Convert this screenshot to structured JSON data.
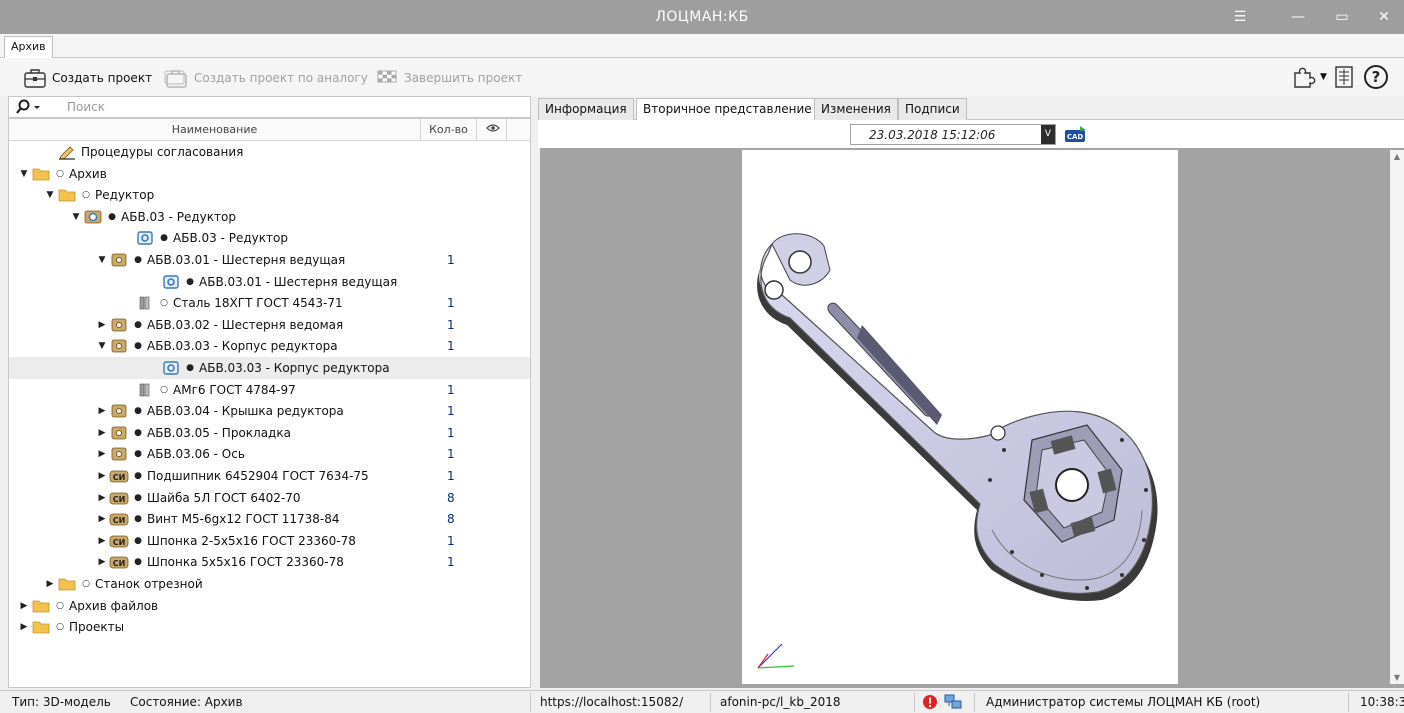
{
  "window": {
    "title": "ЛОЦМАН:КБ",
    "menu_icon": "hamburger-icon",
    "minimize_icon": "minimize-icon",
    "maximize_icon": "maximize-icon",
    "close_icon": "close-icon"
  },
  "menubar": {
    "tab": "Архив"
  },
  "toolbar": {
    "create_project": "Создать проект",
    "create_by_analog": "Создать проект по аналогу",
    "finish_project": "Завершить проект"
  },
  "search": {
    "placeholder": "Поиск"
  },
  "tree": {
    "columns": {
      "name": "Наименование",
      "qty": "Кол-во"
    },
    "rows": [
      {
        "level": 1,
        "arrow": "",
        "icon": "procedure",
        "dot": "",
        "label": "Процедуры согласования",
        "qty": ""
      },
      {
        "level": 0,
        "arrow": "down",
        "icon": "folder",
        "dot": "o",
        "label": "Архив",
        "qty": ""
      },
      {
        "level": 1,
        "arrow": "down",
        "icon": "folder",
        "dot": "o",
        "label": "Редуктор",
        "qty": ""
      },
      {
        "level": 2,
        "arrow": "down",
        "icon": "assembly",
        "dot": "•",
        "label": "АБВ.03 - Редуктор",
        "qty": ""
      },
      {
        "level": 4,
        "arrow": "",
        "icon": "model-blue",
        "dot": "•",
        "label": "АБВ.03 - Редуктор",
        "qty": ""
      },
      {
        "level": 3,
        "arrow": "down",
        "icon": "part",
        "dot": "•",
        "label": "АБВ.03.01 - Шестерня ведущая",
        "qty": "1"
      },
      {
        "level": 5,
        "arrow": "",
        "icon": "model-blue",
        "dot": "•",
        "label": "АБВ.03.01 - Шестерня ведущая",
        "qty": ""
      },
      {
        "level": 4,
        "arrow": "",
        "icon": "material",
        "dot": "o",
        "label": "Сталь 18ХГТ ГОСТ 4543-71",
        "qty": "1"
      },
      {
        "level": 3,
        "arrow": "right",
        "icon": "part",
        "dot": "•",
        "label": "АБВ.03.02 - Шестерня ведомая",
        "qty": "1"
      },
      {
        "level": 3,
        "arrow": "down",
        "icon": "part",
        "dot": "•",
        "label": "АБВ.03.03 - Корпус редуктора",
        "qty": "1"
      },
      {
        "level": 5,
        "arrow": "",
        "icon": "model-blue",
        "dot": "•",
        "label": "АБВ.03.03 - Корпус редуктора",
        "qty": "",
        "selected": true
      },
      {
        "level": 4,
        "arrow": "",
        "icon": "material",
        "dot": "o",
        "label": "АМг6 ГОСТ 4784-97",
        "qty": "1"
      },
      {
        "level": 3,
        "arrow": "right",
        "icon": "part",
        "dot": "•",
        "label": "АБВ.03.04 - Крышка редуктора",
        "qty": "1"
      },
      {
        "level": 3,
        "arrow": "right",
        "icon": "part",
        "dot": "•",
        "label": "АБВ.03.05 - Прокладка",
        "qty": "1"
      },
      {
        "level": 3,
        "arrow": "right",
        "icon": "part",
        "dot": "•",
        "label": "АБВ.03.06 - Ось",
        "qty": "1"
      },
      {
        "level": 3,
        "arrow": "right",
        "icon": "standard",
        "dot": "•",
        "label": "Подшипник 6452904 ГОСТ 7634-75",
        "qty": "1"
      },
      {
        "level": 3,
        "arrow": "right",
        "icon": "standard",
        "dot": "•",
        "label": "Шайба 5Л ГОСТ 6402-70",
        "qty": "8"
      },
      {
        "level": 3,
        "arrow": "right",
        "icon": "standard",
        "dot": "•",
        "label": "Винт М5-6gx12 ГОСТ 11738-84",
        "qty": "8"
      },
      {
        "level": 3,
        "arrow": "right",
        "icon": "standard",
        "dot": "•",
        "label": "Шпонка 2-5x5x16 ГОСТ 23360-78",
        "qty": "1"
      },
      {
        "level": 3,
        "arrow": "right",
        "icon": "standard",
        "dot": "•",
        "label": "Шпонка 5x5x16 ГОСТ 23360-78",
        "qty": "1"
      },
      {
        "level": 1,
        "arrow": "right",
        "icon": "folder",
        "dot": "o",
        "label": "Станок отрезной",
        "qty": ""
      },
      {
        "level": 0,
        "arrow": "right",
        "icon": "folder",
        "dot": "o",
        "label": "Архив файлов",
        "qty": ""
      },
      {
        "level": 0,
        "arrow": "right",
        "icon": "folder",
        "dot": "o",
        "label": "Проекты",
        "qty": ""
      }
    ]
  },
  "tabs": [
    "Информация",
    "Вторичное представление",
    "Изменения",
    "Подписи"
  ],
  "active_tab": 1,
  "viewer": {
    "date": "23.03.2018 15:12:06",
    "cad_badge": "CAD"
  },
  "status": {
    "type": "Тип: 3D-модель",
    "state": "Состояние: Архив",
    "url": "https://localhost:15082/",
    "db": "afonin-pc/l_kb_2018",
    "user": "Администратор системы ЛОЦМАН КБ (root)",
    "time": "10:38:3"
  },
  "colors": {
    "titlebar": "#9e9e9e",
    "qty_text": "#0a2a7a",
    "folder": "#f2c14e",
    "part": "#c9a86a",
    "model": "#3a78c2"
  }
}
